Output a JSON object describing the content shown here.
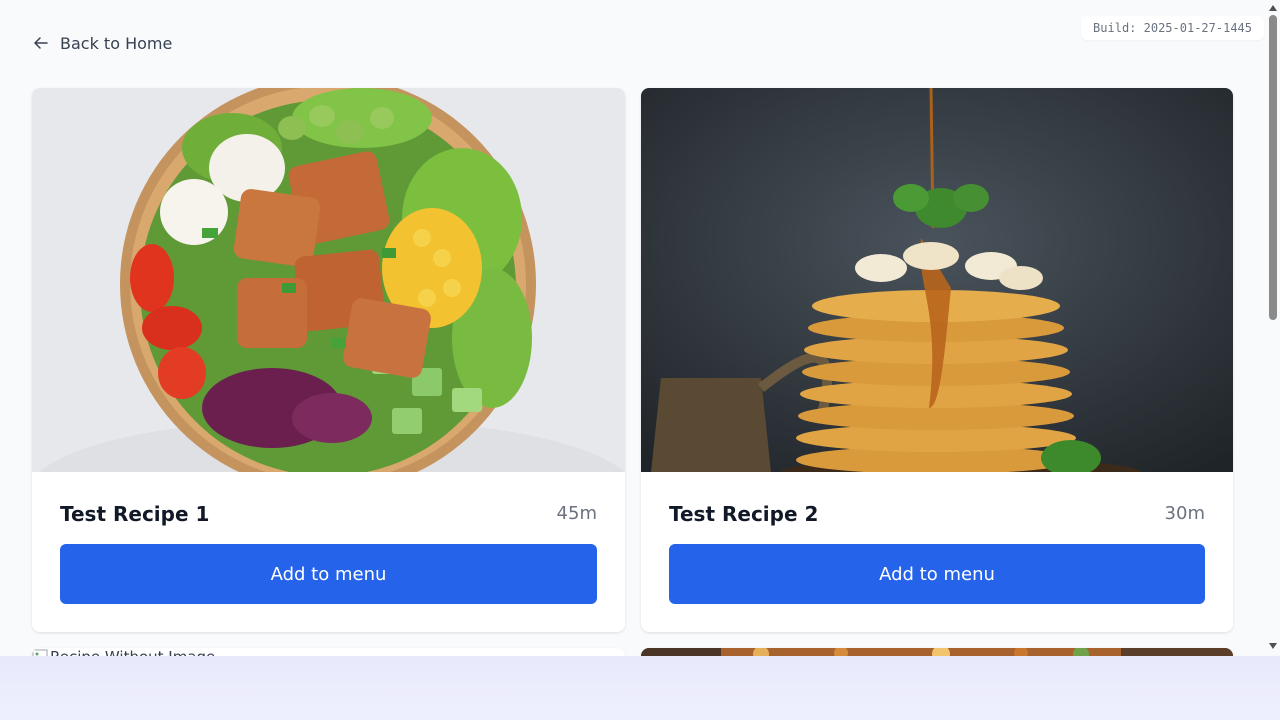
{
  "nav": {
    "back_label": "Back to Home",
    "back_icon": "arrow-left-icon"
  },
  "build": {
    "label": "Build: 2025-01-27-1445"
  },
  "recipes": [
    {
      "title": "Test Recipe 1",
      "time": "45m",
      "button_label": "Add to menu",
      "image": "salad-bowl"
    },
    {
      "title": "Test Recipe 2",
      "time": "30m",
      "button_label": "Add to menu",
      "image": "pancake-stack"
    },
    {
      "title": "",
      "time": "",
      "button_label": "",
      "image_alt": "Recipe Without Image"
    },
    {
      "title": "",
      "time": "",
      "button_label": "",
      "image": "pasta-dish"
    }
  ],
  "colors": {
    "accent": "#2563eb",
    "page_background": "#f8fafc",
    "card_background": "#ffffff"
  }
}
